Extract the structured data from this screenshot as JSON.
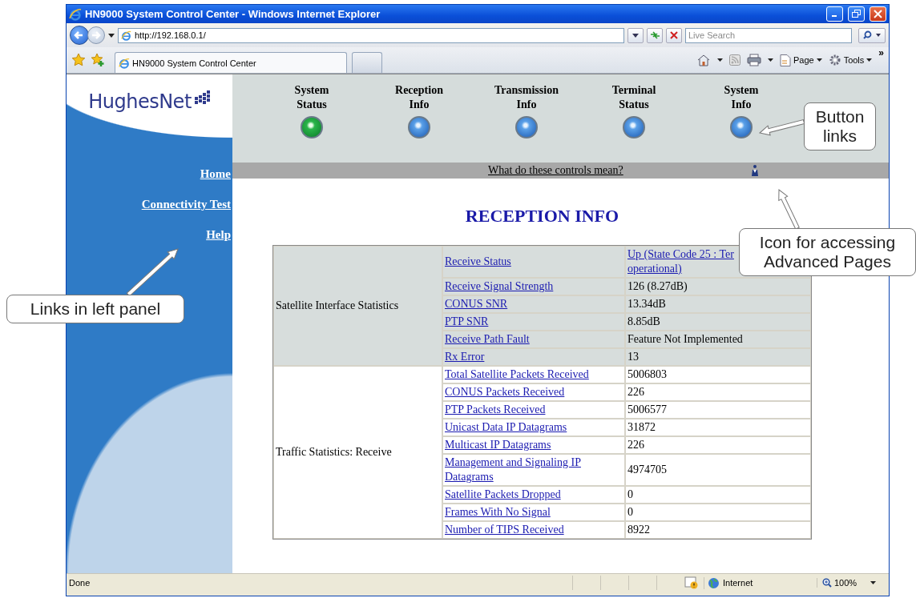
{
  "window": {
    "title": "HN9000 System Control Center - Windows Internet Explorer"
  },
  "address_bar": {
    "url": "http://192.168.0.1/"
  },
  "search": {
    "placeholder": "Live Search"
  },
  "tabs": [
    {
      "label": "HN9000 System Control Center",
      "selected": true
    }
  ],
  "command_bar": {
    "items": [
      {
        "label": "Page"
      },
      {
        "label": "Tools"
      }
    ],
    "overflow": "»"
  },
  "page": {
    "logo": "HughesNet",
    "nav": [
      {
        "label": "System Status",
        "selected": true
      },
      {
        "label": "Reception Info",
        "selected": false
      },
      {
        "label": "Transmission Info",
        "selected": false
      },
      {
        "label": "Terminal Status",
        "selected": false
      },
      {
        "label": "System Info",
        "selected": false
      }
    ],
    "help_link": "What do these controls mean?",
    "sidebar": {
      "items": [
        {
          "label": "Home"
        },
        {
          "label": "Connectivity Test"
        },
        {
          "label": "Help"
        }
      ]
    },
    "heading": "RECEPTION INFO",
    "table": {
      "groups": [
        {
          "name": "Satellite Interface Statistics",
          "rows": [
            {
              "label": "Receive Status",
              "value": "Up (State Code 25 : Ter\noperational)",
              "value_link": true
            },
            {
              "label": "Receive Signal Strength",
              "value": "126 (8.27dB)",
              "value_link": false
            },
            {
              "label": "CONUS SNR",
              "value": "13.34dB",
              "value_link": false
            },
            {
              "label": "PTP SNR",
              "value": "8.85dB",
              "value_link": false
            },
            {
              "label": "Receive Path Fault",
              "value": "Feature Not Implemented",
              "value_link": false
            },
            {
              "label": "Rx Error",
              "value": "13",
              "value_link": false
            }
          ]
        },
        {
          "name": "Traffic Statistics: Receive",
          "rows": [
            {
              "label": "Total Satellite Packets Received",
              "value": "5006803",
              "value_link": false
            },
            {
              "label": "CONUS Packets Received",
              "value": "226",
              "value_link": false
            },
            {
              "label": "PTP Packets Received",
              "value": "5006577",
              "value_link": false
            },
            {
              "label": "Unicast Data IP Datagrams",
              "value": "31872",
              "value_link": false
            },
            {
              "label": "Multicast IP Datagrams",
              "value": "226",
              "value_link": false
            },
            {
              "label": "Management and Signaling IP Datagrams",
              "value": "4974705",
              "value_link": false
            },
            {
              "label": "Satellite Packets Dropped",
              "value": "0",
              "value_link": false
            },
            {
              "label": "Frames With No Signal",
              "value": "0",
              "value_link": false
            },
            {
              "label": "Number of TIPS Received",
              "value": "8922",
              "value_link": false
            }
          ]
        }
      ]
    }
  },
  "status_bar": {
    "text": "Done",
    "zone": "Internet",
    "zoom": "100%"
  },
  "callouts": [
    {
      "kind": "buttons",
      "text": "Button links"
    },
    {
      "kind": "icon",
      "text": "Icon for accessing Advanced Pages"
    },
    {
      "kind": "sidebar",
      "text": "Links in left panel"
    }
  ]
}
